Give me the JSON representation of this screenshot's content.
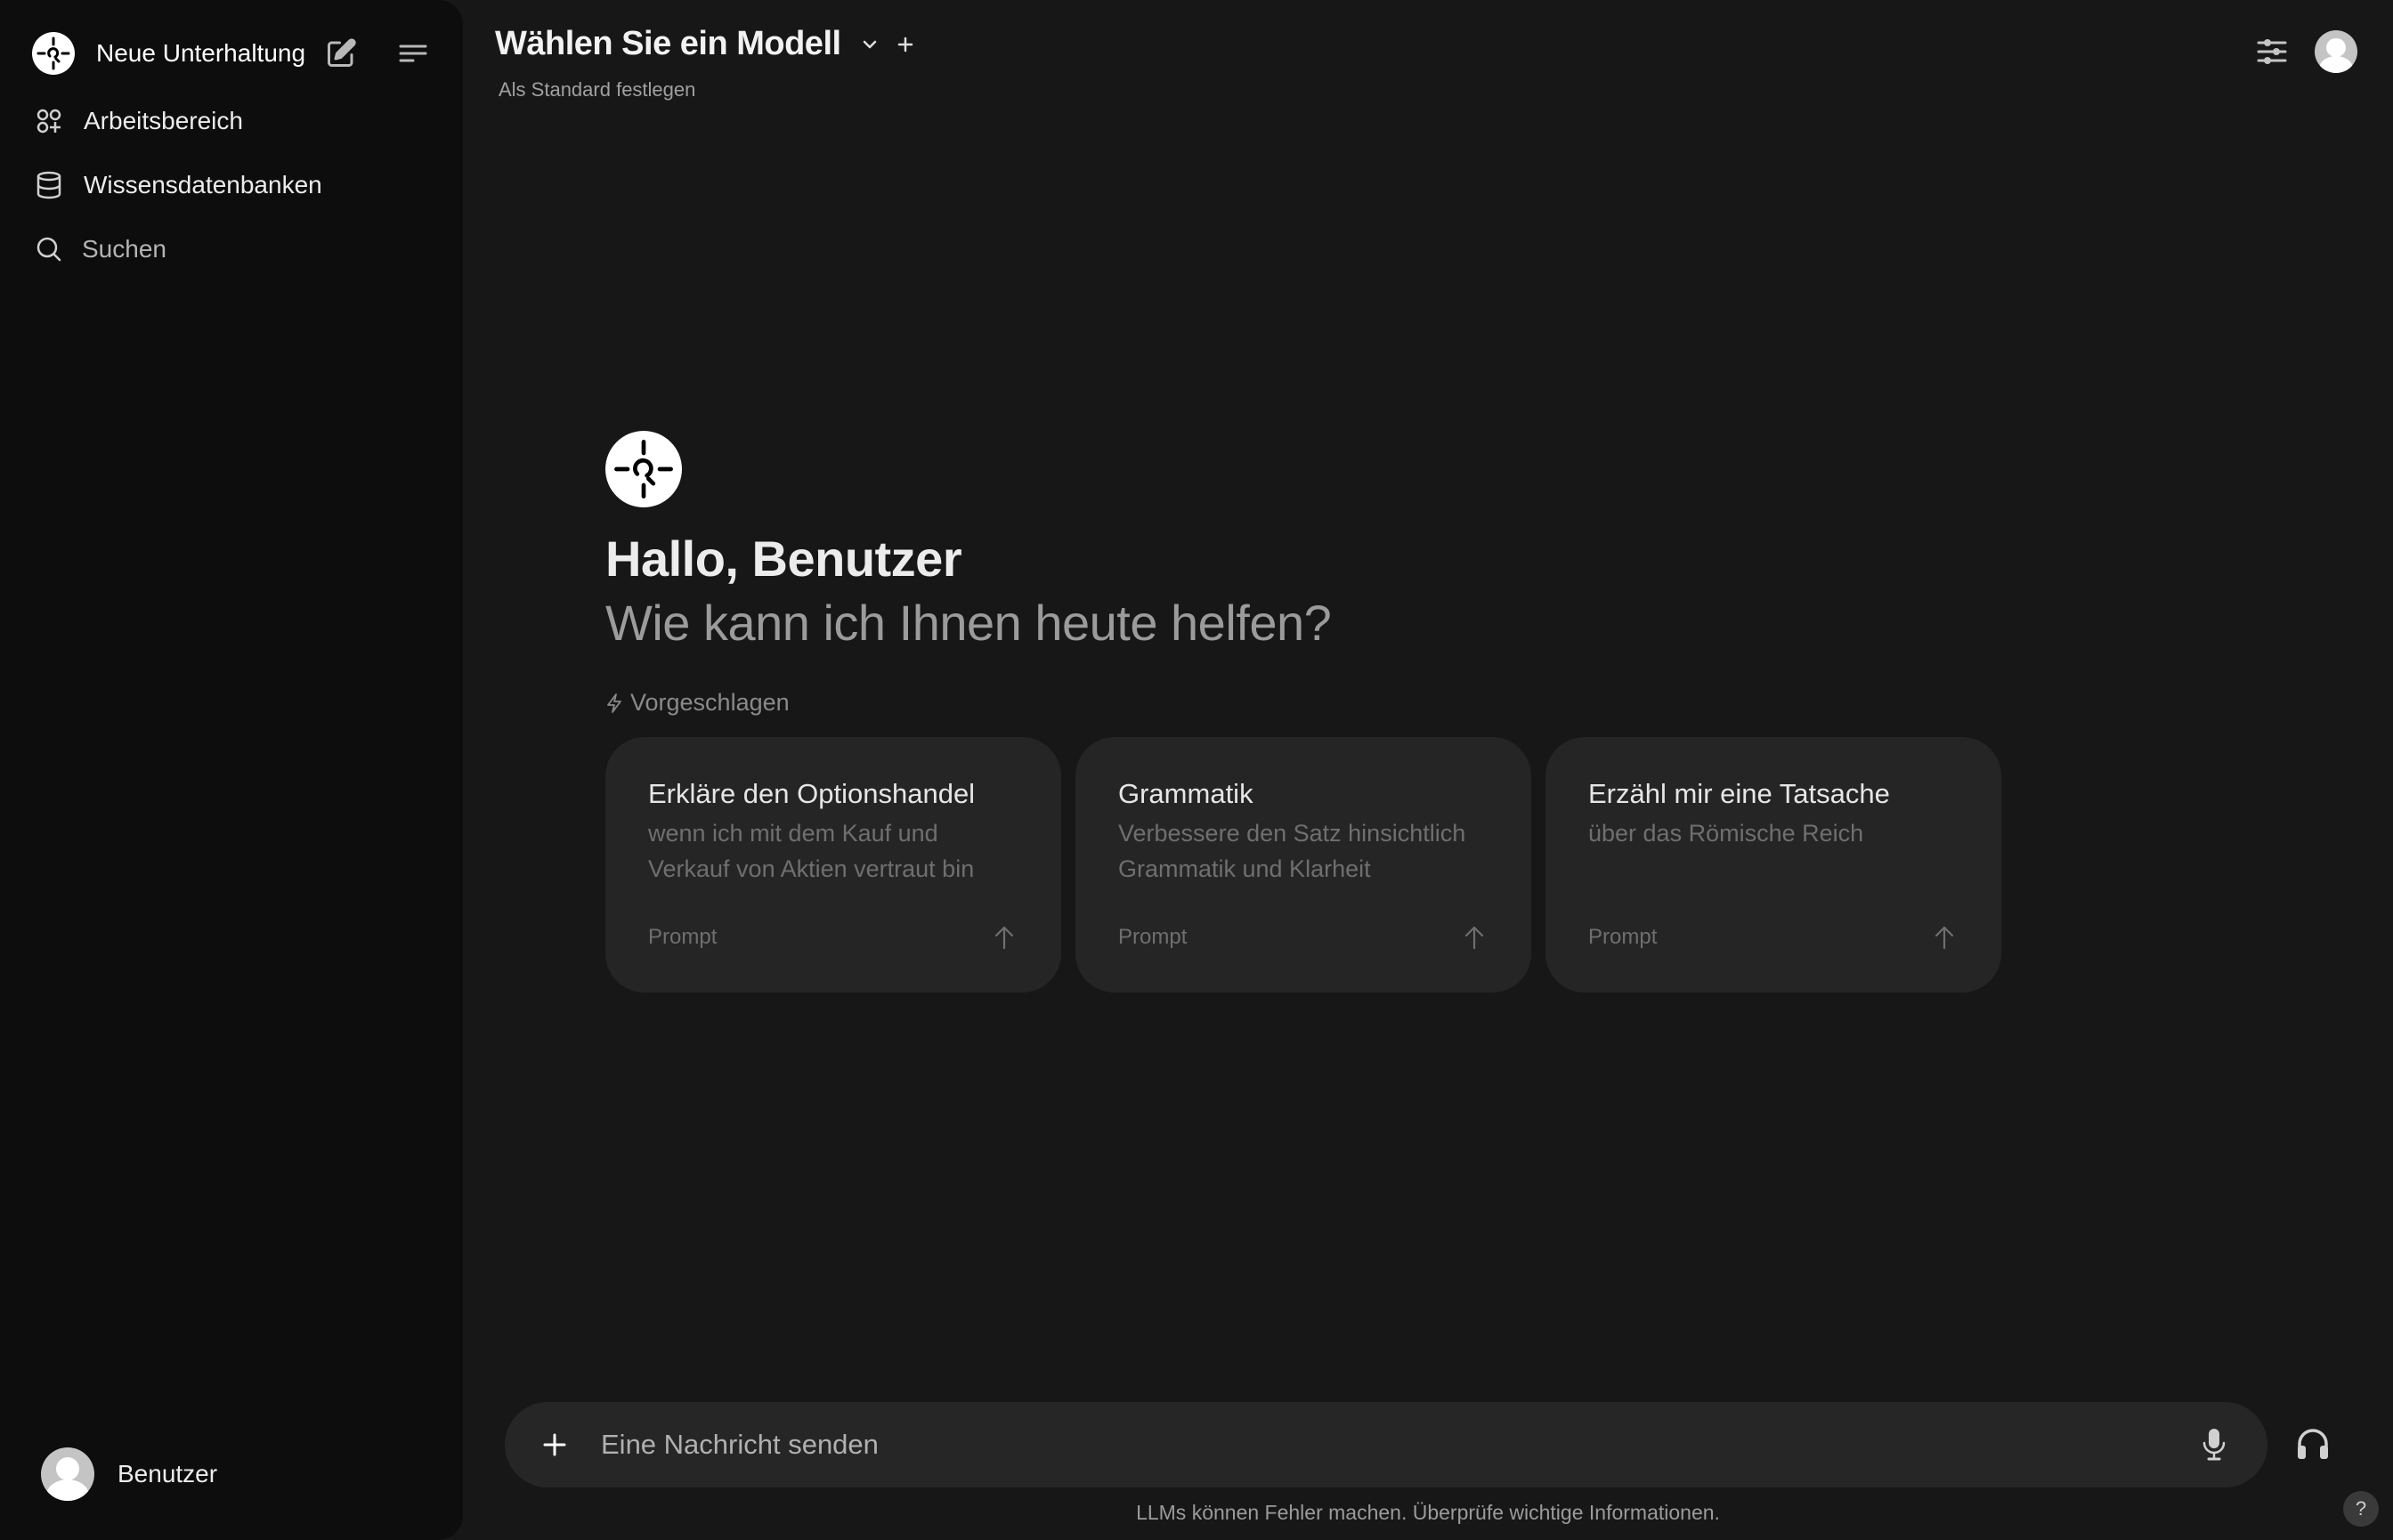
{
  "sidebar": {
    "new_chat_label": "Neue Unterhaltung",
    "items": [
      {
        "label": "Arbeitsbereich",
        "icon": "workspace-icon"
      },
      {
        "label": "Wissensdatenbanken",
        "icon": "database-icon"
      },
      {
        "label": "Suchen",
        "icon": "search-icon"
      }
    ],
    "user_name": "Benutzer"
  },
  "header": {
    "model_title": "Wählen Sie ein Modell",
    "set_default": "Als Standard festlegen"
  },
  "hero": {
    "greeting": "Hallo, Benutzer",
    "subtitle": "Wie kann ich Ihnen heute helfen?",
    "suggested_label": "Vorgeschlagen"
  },
  "suggestions": [
    {
      "title": "Erkläre den Optionshandel",
      "subtitle": "wenn ich mit dem Kauf und Verkauf von Aktien vertraut bin",
      "footer": "Prompt"
    },
    {
      "title": "Grammatik",
      "subtitle": "Verbessere den Satz hinsichtlich Grammatik und Klarheit",
      "footer": "Prompt"
    },
    {
      "title": "Erzähl mir eine Tatsache",
      "subtitle": "über das Römische Reich",
      "footer": "Prompt"
    }
  ],
  "composer": {
    "placeholder": "Eine Nachricht senden",
    "value": ""
  },
  "footer": {
    "disclaimer": "LLMs können Fehler machen. Überprüfe wichtige Informationen.",
    "help": "?"
  },
  "colors": {
    "sidebar_bg": "#0d0d0d",
    "main_bg": "#171717",
    "card_bg": "#252525",
    "composer_bg": "#262626"
  }
}
